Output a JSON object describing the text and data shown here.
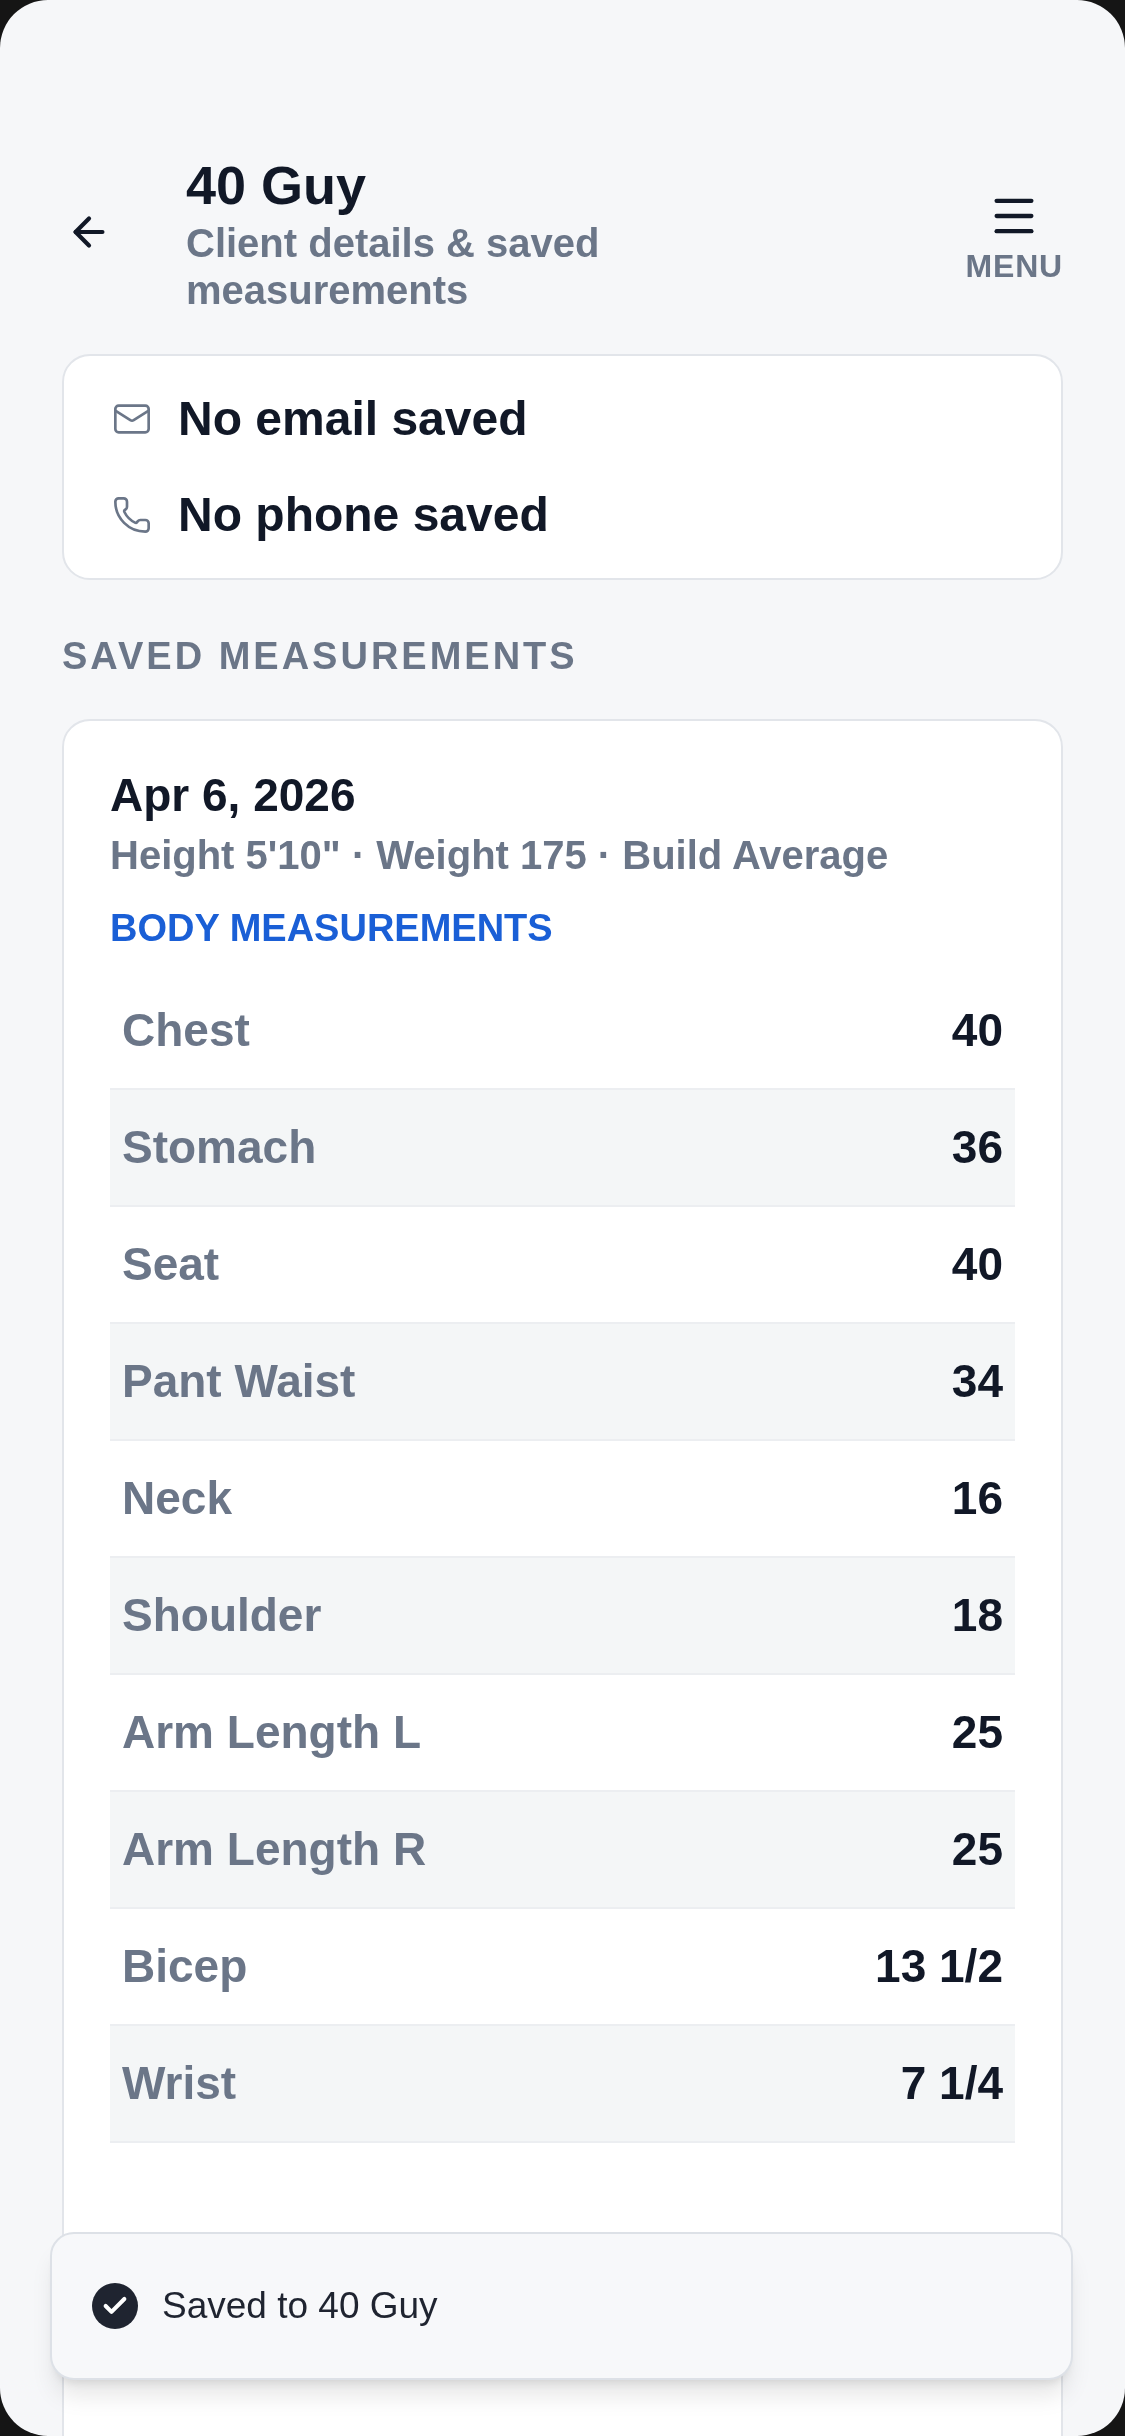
{
  "header": {
    "title": "40 Guy",
    "subtitle": "Client details & saved measurements",
    "menu_label": "MENU"
  },
  "contact": [
    {
      "kind": "email",
      "text": "No email saved"
    },
    {
      "kind": "phone",
      "text": "No phone saved"
    }
  ],
  "section_title": "SAVED MEASUREMENTS",
  "measurement": {
    "date": "Apr 6, 2026",
    "summary": "Height 5'10\" · Weight 175 · Build Average",
    "group_title": "BODY MEASUREMENTS",
    "rows": [
      {
        "label": "Chest",
        "value": "40"
      },
      {
        "label": "Stomach",
        "value": "36"
      },
      {
        "label": "Seat",
        "value": "40"
      },
      {
        "label": "Pant Waist",
        "value": "34"
      },
      {
        "label": "Neck",
        "value": "16"
      },
      {
        "label": "Shoulder",
        "value": "18"
      },
      {
        "label": "Arm Length L",
        "value": "25"
      },
      {
        "label": "Arm Length R",
        "value": "25"
      },
      {
        "label": "Bicep",
        "value": "13 1/2"
      },
      {
        "label": "Wrist",
        "value": "7 1/4"
      }
    ]
  },
  "toast": {
    "text": "Saved to 40 Guy"
  }
}
